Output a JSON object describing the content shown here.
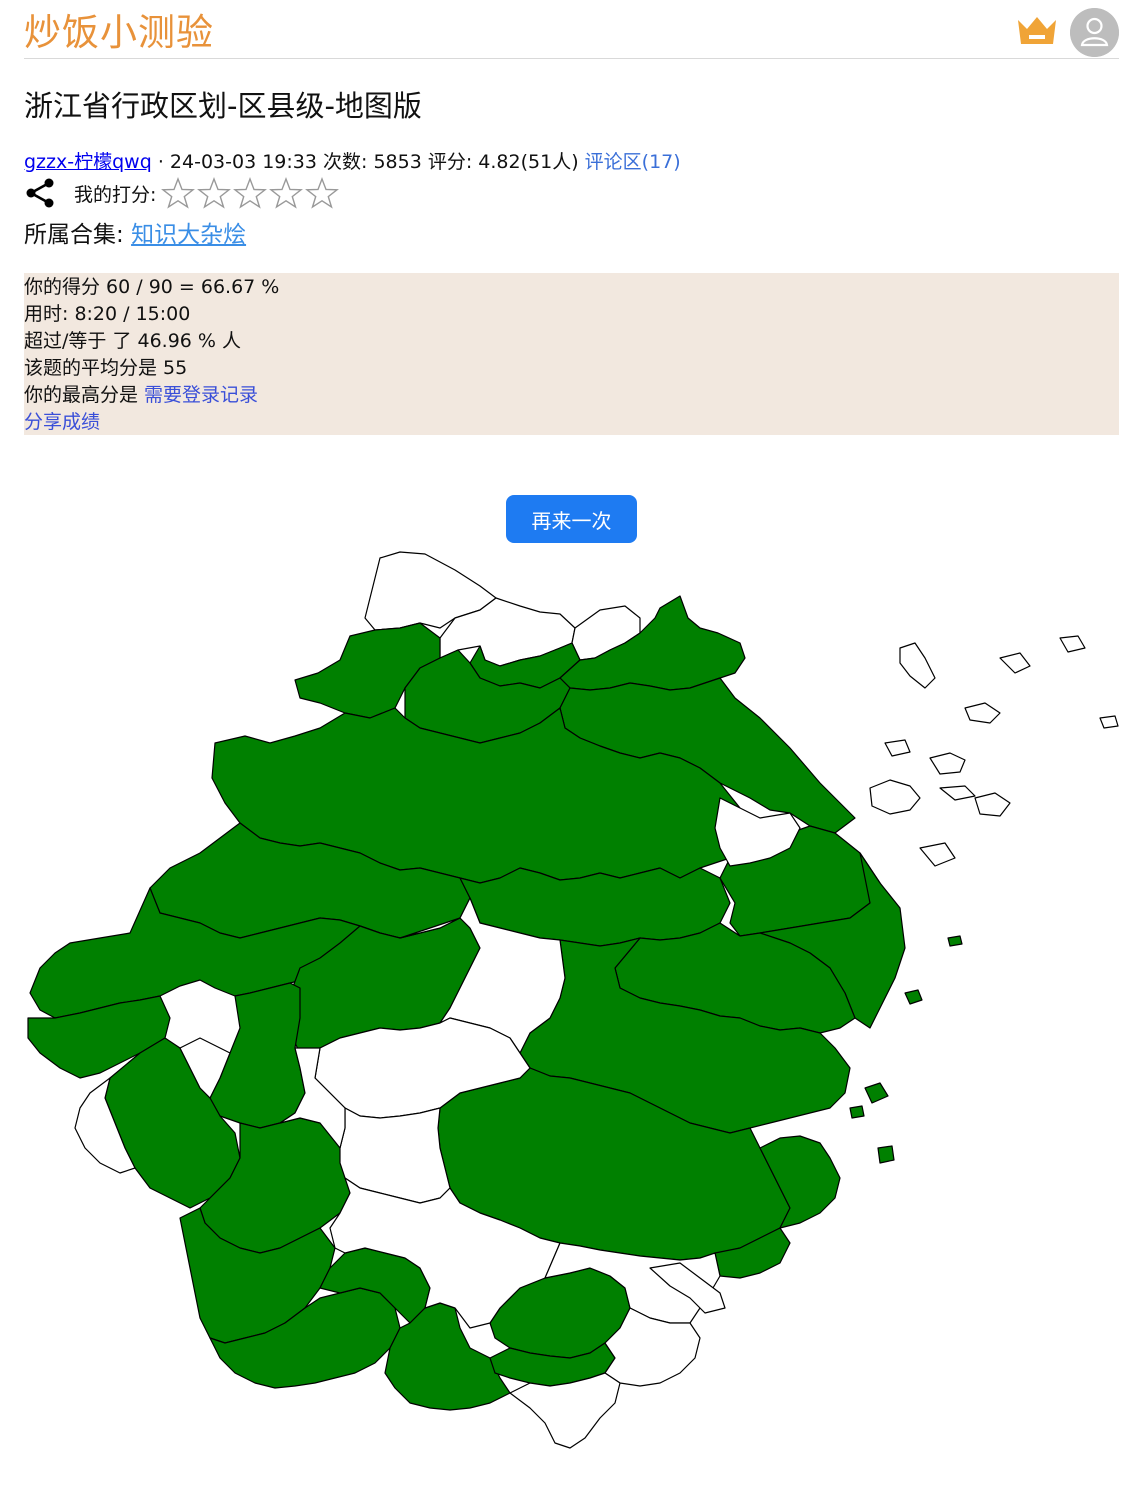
{
  "site": {
    "title": "炒饭小测验"
  },
  "quiz": {
    "title": "浙江省行政区划-区县级-地图版",
    "author": "gzzx-柠檬qwq",
    "separator": "·",
    "date": "24-03-03 19:33",
    "plays_label": "次数: 5853",
    "rating_label": "评分: 4.82(51人)",
    "comments_label": "评论区(17)"
  },
  "my_rating": {
    "label": "我的打分:",
    "stars": 5,
    "filled": 0
  },
  "collection": {
    "label": "所属合集:",
    "link": "知识大杂烩"
  },
  "result": {
    "score_line": "你的得分 60 / 90 = 66.67 %",
    "time_line": "用时: 8:20 / 15:00",
    "beat_line": "超过/等于 了 46.96 % 人",
    "avg_line": "该题的平均分是 55",
    "best_prefix": "你的最高分是 ",
    "best_link": "需要登录记录",
    "share_link": "分享成绩"
  },
  "retry_button": "再来一次",
  "colors": {
    "brand": "#e8923a",
    "correct": "#008000",
    "unanswered": "#ffffff",
    "button": "#1e7bf2",
    "result_bg": "#f2e8df"
  },
  "icons": [
    "crown-icon",
    "user-avatar-icon",
    "share-icon",
    "star-icon"
  ]
}
